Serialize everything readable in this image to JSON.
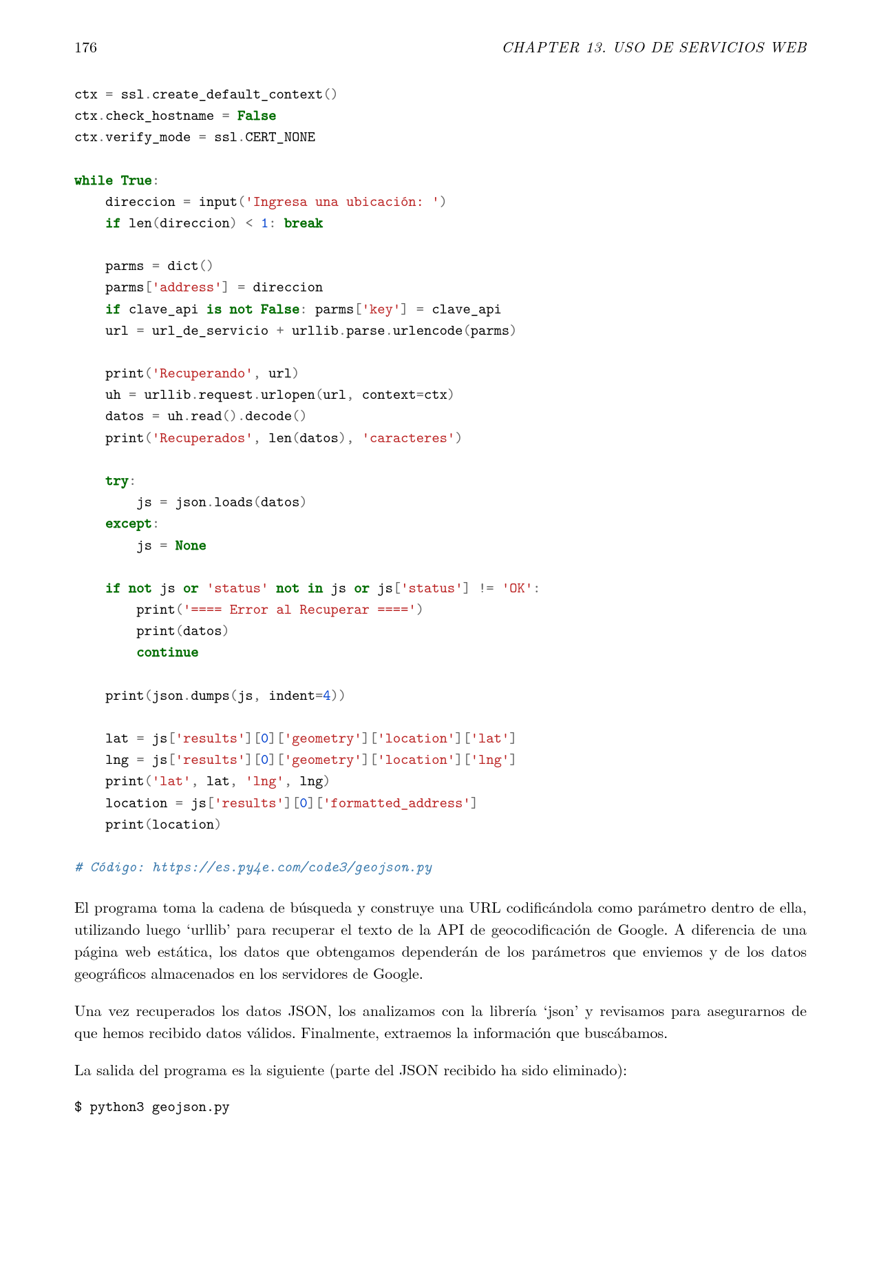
{
  "header": {
    "page_number": "176",
    "chapter_label": "CHAPTER 13.  USO DE SERVICIOS WEB"
  },
  "code": {
    "tokens": [
      [
        "nm",
        "ctx "
      ],
      [
        "op",
        "="
      ],
      [
        "nm",
        " ssl"
      ],
      [
        "op",
        "."
      ],
      [
        "nm",
        "create_default_context"
      ],
      [
        "op",
        "()"
      ],
      [
        "nl",
        ""
      ],
      [
        "nm",
        "ctx"
      ],
      [
        "op",
        "."
      ],
      [
        "nm",
        "check_hostname "
      ],
      [
        "op",
        "="
      ],
      [
        "nm",
        " "
      ],
      [
        "bool",
        "False"
      ],
      [
        "nl",
        ""
      ],
      [
        "nm",
        "ctx"
      ],
      [
        "op",
        "."
      ],
      [
        "nm",
        "verify_mode "
      ],
      [
        "op",
        "="
      ],
      [
        "nm",
        " ssl"
      ],
      [
        "op",
        "."
      ],
      [
        "nm",
        "CERT_NONE"
      ],
      [
        "nl",
        ""
      ],
      [
        "nl",
        ""
      ],
      [
        "kw",
        "while"
      ],
      [
        "nm",
        " "
      ],
      [
        "bool",
        "True"
      ],
      [
        "op",
        ":"
      ],
      [
        "nl",
        ""
      ],
      [
        "nm",
        "    direccion "
      ],
      [
        "op",
        "="
      ],
      [
        "nm",
        " input"
      ],
      [
        "op",
        "("
      ],
      [
        "str",
        "'Ingresa una ubicación: '"
      ],
      [
        "op",
        ")"
      ],
      [
        "nl",
        ""
      ],
      [
        "nm",
        "    "
      ],
      [
        "kw",
        "if"
      ],
      [
        "nm",
        " len"
      ],
      [
        "op",
        "("
      ],
      [
        "nm",
        "direccion"
      ],
      [
        "op",
        ")"
      ],
      [
        "nm",
        " "
      ],
      [
        "op",
        "<"
      ],
      [
        "nm",
        " "
      ],
      [
        "num",
        "1"
      ],
      [
        "op",
        ":"
      ],
      [
        "nm",
        " "
      ],
      [
        "kw",
        "break"
      ],
      [
        "nl",
        ""
      ],
      [
        "nl",
        ""
      ],
      [
        "nm",
        "    parms "
      ],
      [
        "op",
        "="
      ],
      [
        "nm",
        " dict"
      ],
      [
        "op",
        "()"
      ],
      [
        "nl",
        ""
      ],
      [
        "nm",
        "    parms"
      ],
      [
        "op",
        "["
      ],
      [
        "str",
        "'address'"
      ],
      [
        "op",
        "]"
      ],
      [
        "nm",
        " "
      ],
      [
        "op",
        "="
      ],
      [
        "nm",
        " direccion"
      ],
      [
        "nl",
        ""
      ],
      [
        "nm",
        "    "
      ],
      [
        "kw",
        "if"
      ],
      [
        "nm",
        " clave_api "
      ],
      [
        "kw",
        "is not"
      ],
      [
        "nm",
        " "
      ],
      [
        "bool",
        "False"
      ],
      [
        "op",
        ":"
      ],
      [
        "nm",
        " parms"
      ],
      [
        "op",
        "["
      ],
      [
        "str",
        "'key'"
      ],
      [
        "op",
        "]"
      ],
      [
        "nm",
        " "
      ],
      [
        "op",
        "="
      ],
      [
        "nm",
        " clave_api"
      ],
      [
        "nl",
        ""
      ],
      [
        "nm",
        "    url "
      ],
      [
        "op",
        "="
      ],
      [
        "nm",
        " url_de_servicio "
      ],
      [
        "op",
        "+"
      ],
      [
        "nm",
        " urllib"
      ],
      [
        "op",
        "."
      ],
      [
        "nm",
        "parse"
      ],
      [
        "op",
        "."
      ],
      [
        "nm",
        "urlencode"
      ],
      [
        "op",
        "("
      ],
      [
        "nm",
        "parms"
      ],
      [
        "op",
        ")"
      ],
      [
        "nl",
        ""
      ],
      [
        "nl",
        ""
      ],
      [
        "nm",
        "    print"
      ],
      [
        "op",
        "("
      ],
      [
        "str",
        "'Recuperando'"
      ],
      [
        "op",
        ","
      ],
      [
        "nm",
        " url"
      ],
      [
        "op",
        ")"
      ],
      [
        "nl",
        ""
      ],
      [
        "nm",
        "    uh "
      ],
      [
        "op",
        "="
      ],
      [
        "nm",
        " urllib"
      ],
      [
        "op",
        "."
      ],
      [
        "nm",
        "request"
      ],
      [
        "op",
        "."
      ],
      [
        "nm",
        "urlopen"
      ],
      [
        "op",
        "("
      ],
      [
        "nm",
        "url"
      ],
      [
        "op",
        ","
      ],
      [
        "nm",
        " context"
      ],
      [
        "op",
        "="
      ],
      [
        "nm",
        "ctx"
      ],
      [
        "op",
        ")"
      ],
      [
        "nl",
        ""
      ],
      [
        "nm",
        "    datos "
      ],
      [
        "op",
        "="
      ],
      [
        "nm",
        " uh"
      ],
      [
        "op",
        "."
      ],
      [
        "nm",
        "read"
      ],
      [
        "op",
        "()"
      ],
      [
        "op",
        "."
      ],
      [
        "nm",
        "decode"
      ],
      [
        "op",
        "()"
      ],
      [
        "nl",
        ""
      ],
      [
        "nm",
        "    print"
      ],
      [
        "op",
        "("
      ],
      [
        "str",
        "'Recuperados'"
      ],
      [
        "op",
        ","
      ],
      [
        "nm",
        " len"
      ],
      [
        "op",
        "("
      ],
      [
        "nm",
        "datos"
      ],
      [
        "op",
        ")"
      ],
      [
        "op",
        ","
      ],
      [
        "nm",
        " "
      ],
      [
        "str",
        "'caracteres'"
      ],
      [
        "op",
        ")"
      ],
      [
        "nl",
        ""
      ],
      [
        "nl",
        ""
      ],
      [
        "nm",
        "    "
      ],
      [
        "kw",
        "try"
      ],
      [
        "op",
        ":"
      ],
      [
        "nl",
        ""
      ],
      [
        "nm",
        "        js "
      ],
      [
        "op",
        "="
      ],
      [
        "nm",
        " json"
      ],
      [
        "op",
        "."
      ],
      [
        "nm",
        "loads"
      ],
      [
        "op",
        "("
      ],
      [
        "nm",
        "datos"
      ],
      [
        "op",
        ")"
      ],
      [
        "nl",
        ""
      ],
      [
        "nm",
        "    "
      ],
      [
        "kw",
        "except"
      ],
      [
        "op",
        ":"
      ],
      [
        "nl",
        ""
      ],
      [
        "nm",
        "        js "
      ],
      [
        "op",
        "="
      ],
      [
        "nm",
        " "
      ],
      [
        "none",
        "None"
      ],
      [
        "nl",
        ""
      ],
      [
        "nl",
        ""
      ],
      [
        "nm",
        "    "
      ],
      [
        "kw",
        "if"
      ],
      [
        "nm",
        " "
      ],
      [
        "kw",
        "not"
      ],
      [
        "nm",
        " js "
      ],
      [
        "kw",
        "or"
      ],
      [
        "nm",
        " "
      ],
      [
        "str",
        "'status'"
      ],
      [
        "nm",
        " "
      ],
      [
        "kw",
        "not in"
      ],
      [
        "nm",
        " js "
      ],
      [
        "kw",
        "or"
      ],
      [
        "nm",
        " js"
      ],
      [
        "op",
        "["
      ],
      [
        "str",
        "'status'"
      ],
      [
        "op",
        "]"
      ],
      [
        "nm",
        " "
      ],
      [
        "op",
        "!="
      ],
      [
        "nm",
        " "
      ],
      [
        "str",
        "'OK'"
      ],
      [
        "op",
        ":"
      ],
      [
        "nl",
        ""
      ],
      [
        "nm",
        "        print"
      ],
      [
        "op",
        "("
      ],
      [
        "str",
        "'==== Error al Recuperar ===='"
      ],
      [
        "op",
        ")"
      ],
      [
        "nl",
        ""
      ],
      [
        "nm",
        "        print"
      ],
      [
        "op",
        "("
      ],
      [
        "nm",
        "datos"
      ],
      [
        "op",
        ")"
      ],
      [
        "nl",
        ""
      ],
      [
        "nm",
        "        "
      ],
      [
        "kw",
        "continue"
      ],
      [
        "nl",
        ""
      ],
      [
        "nl",
        ""
      ],
      [
        "nm",
        "    print"
      ],
      [
        "op",
        "("
      ],
      [
        "nm",
        "json"
      ],
      [
        "op",
        "."
      ],
      [
        "nm",
        "dumps"
      ],
      [
        "op",
        "("
      ],
      [
        "nm",
        "js"
      ],
      [
        "op",
        ","
      ],
      [
        "nm",
        " indent"
      ],
      [
        "op",
        "="
      ],
      [
        "num",
        "4"
      ],
      [
        "op",
        "))"
      ],
      [
        "nl",
        ""
      ],
      [
        "nl",
        ""
      ],
      [
        "nm",
        "    lat "
      ],
      [
        "op",
        "="
      ],
      [
        "nm",
        " js"
      ],
      [
        "op",
        "["
      ],
      [
        "str",
        "'results'"
      ],
      [
        "op",
        "]["
      ],
      [
        "num",
        "0"
      ],
      [
        "op",
        "]["
      ],
      [
        "str",
        "'geometry'"
      ],
      [
        "op",
        "]["
      ],
      [
        "str",
        "'location'"
      ],
      [
        "op",
        "]["
      ],
      [
        "str",
        "'lat'"
      ],
      [
        "op",
        "]"
      ],
      [
        "nl",
        ""
      ],
      [
        "nm",
        "    lng "
      ],
      [
        "op",
        "="
      ],
      [
        "nm",
        " js"
      ],
      [
        "op",
        "["
      ],
      [
        "str",
        "'results'"
      ],
      [
        "op",
        "]["
      ],
      [
        "num",
        "0"
      ],
      [
        "op",
        "]["
      ],
      [
        "str",
        "'geometry'"
      ],
      [
        "op",
        "]["
      ],
      [
        "str",
        "'location'"
      ],
      [
        "op",
        "]["
      ],
      [
        "str",
        "'lng'"
      ],
      [
        "op",
        "]"
      ],
      [
        "nl",
        ""
      ],
      [
        "nm",
        "    print"
      ],
      [
        "op",
        "("
      ],
      [
        "str",
        "'lat'"
      ],
      [
        "op",
        ","
      ],
      [
        "nm",
        " lat"
      ],
      [
        "op",
        ","
      ],
      [
        "nm",
        " "
      ],
      [
        "str",
        "'lng'"
      ],
      [
        "op",
        ","
      ],
      [
        "nm",
        " lng"
      ],
      [
        "op",
        ")"
      ],
      [
        "nl",
        ""
      ],
      [
        "nm",
        "    location "
      ],
      [
        "op",
        "="
      ],
      [
        "nm",
        " js"
      ],
      [
        "op",
        "["
      ],
      [
        "str",
        "'results'"
      ],
      [
        "op",
        "]["
      ],
      [
        "num",
        "0"
      ],
      [
        "op",
        "]["
      ],
      [
        "str",
        "'formatted_address'"
      ],
      [
        "op",
        "]"
      ],
      [
        "nl",
        ""
      ],
      [
        "nm",
        "    print"
      ],
      [
        "op",
        "("
      ],
      [
        "nm",
        "location"
      ],
      [
        "op",
        ")"
      ],
      [
        "nl",
        ""
      ],
      [
        "nl",
        ""
      ],
      [
        "cmt",
        "# Código: https://es.py4e.com/code3/geojson.py"
      ]
    ]
  },
  "paragraphs": [
    "El programa toma la cadena de búsqueda y construye una URL codificándola como parámetro dentro de ella, utilizando luego ‘urllib’ para recuperar el texto de la API de geocodificación de Google. A diferencia de una página web estática, los datos que obtengamos dependerán de los parámetros que enviemos y de los datos geográficos almacenados en los servidores de Google.",
    "Una vez recuperados los datos JSON, los analizamos con la librería ‘json’ y revisamos para asegurarnos de que hemos recibido datos válidos. Finalmente, extraemos la información que buscábamos.",
    "La salida del programa es la siguiente (parte del JSON recibido ha sido eliminado):"
  ],
  "shell": "$ python3 geojson.py"
}
